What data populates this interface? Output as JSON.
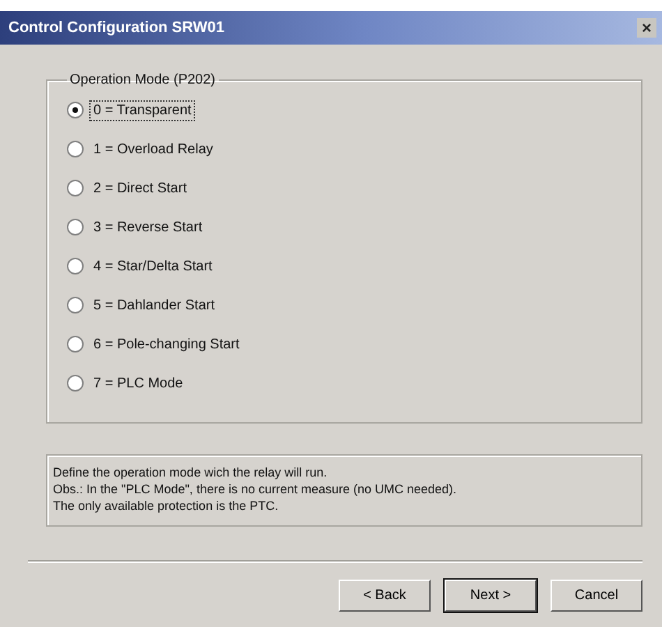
{
  "window": {
    "title": "Control Configuration SRW01",
    "close": "×"
  },
  "group": {
    "title": "Operation Mode (P202)",
    "options": [
      {
        "label": "0 = Transparent",
        "selected": true
      },
      {
        "label": "1 = Overload Relay",
        "selected": false
      },
      {
        "label": "2 = Direct Start",
        "selected": false
      },
      {
        "label": "3 = Reverse Start",
        "selected": false
      },
      {
        "label": "4 = Star/Delta Start",
        "selected": false
      },
      {
        "label": "5 = Dahlander Start",
        "selected": false
      },
      {
        "label": "6 = Pole-changing Start",
        "selected": false
      },
      {
        "label": "7 = PLC Mode",
        "selected": false
      }
    ]
  },
  "description": [
    "Define the operation mode wich the relay will run.",
    "Obs.: In the \"PLC Mode\", there is no current measure (no UMC needed).",
    "The only available protection is the PTC."
  ],
  "buttons": [
    {
      "label": "< Back",
      "default": false
    },
    {
      "label": "Next >",
      "default": true
    },
    {
      "label": "Cancel",
      "default": false
    }
  ]
}
